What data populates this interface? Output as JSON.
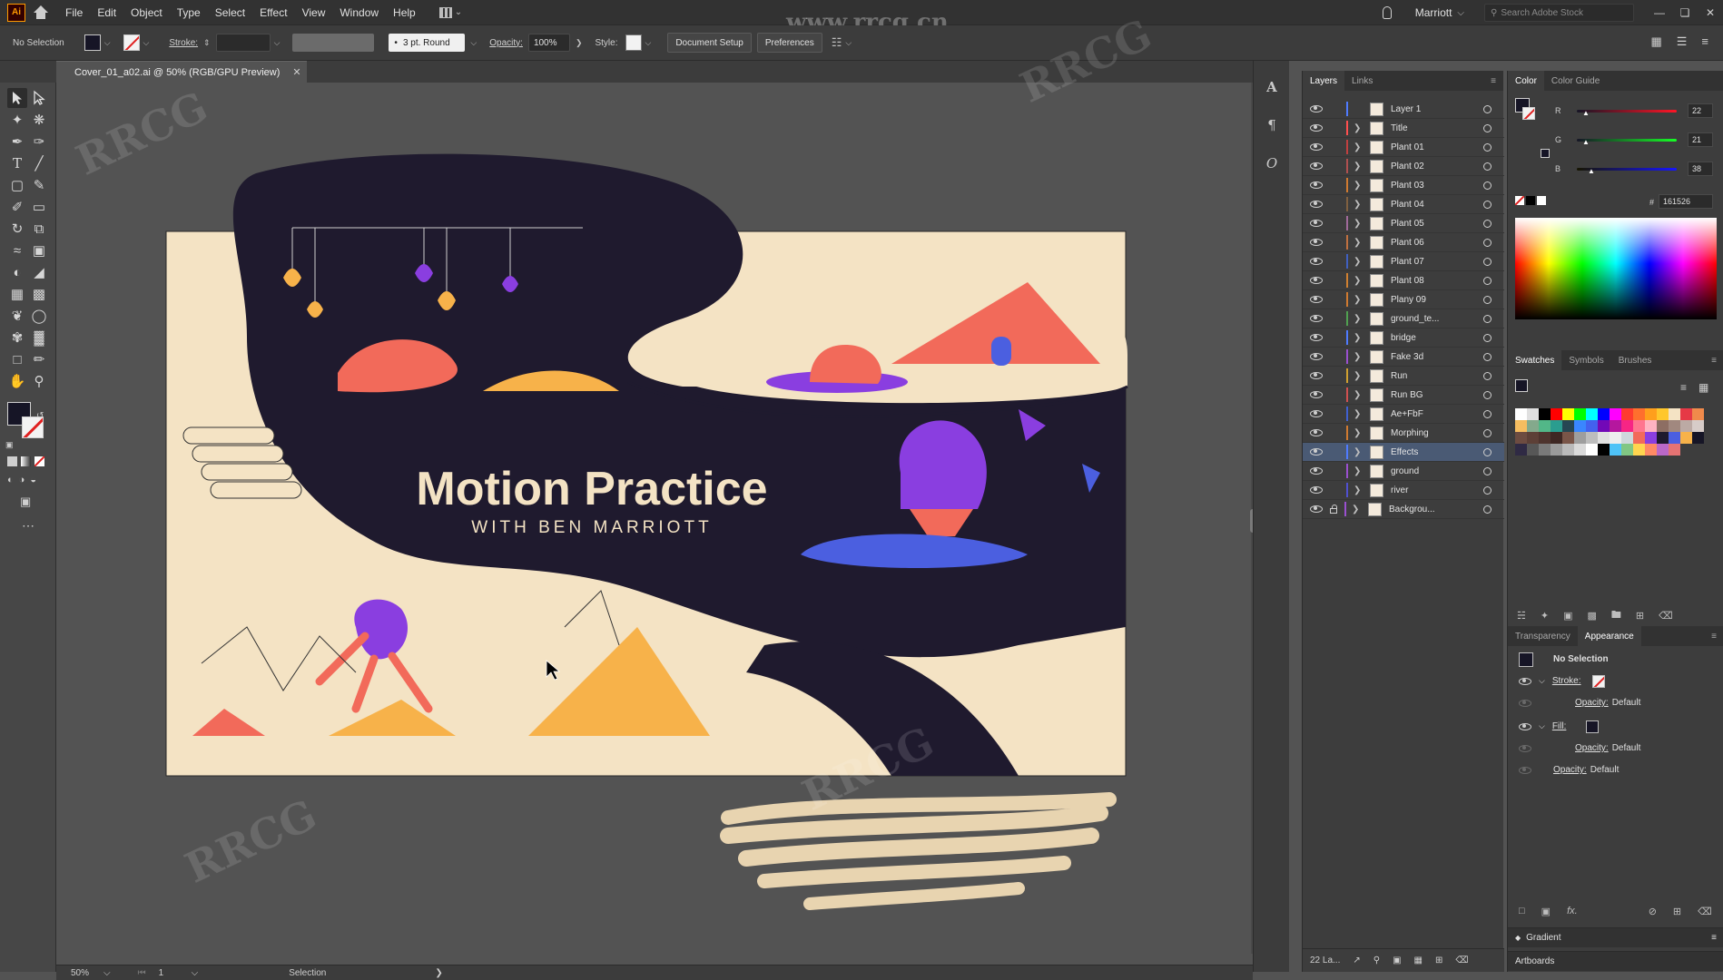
{
  "app": {
    "logo": "Ai"
  },
  "menu": [
    "File",
    "Edit",
    "Object",
    "Type",
    "Select",
    "Effect",
    "View",
    "Window",
    "Help"
  ],
  "header": {
    "user": "Marriott",
    "search_placeholder": "Search Adobe Stock",
    "watermark_top": "www.rrcg.cn"
  },
  "control": {
    "selection_status": "No Selection",
    "stroke_label": "Stroke:",
    "brush": "3 pt. Round",
    "opacity_label": "Opacity:",
    "opacity_value": "100%",
    "style_label": "Style:",
    "doc_setup_label": "Document Setup",
    "preferences_label": "Preferences"
  },
  "document": {
    "tab_title": "Cover_01_a02.ai @ 50% (RGB/GPU Preview)",
    "artwork_title": "Motion Practice",
    "artwork_subtitle": "WITH BEN MARRIOTT"
  },
  "status": {
    "zoom": "50%",
    "artboard_number": "1",
    "tool": "Selection",
    "layer_count": "22 La..."
  },
  "layers_panel": {
    "tabs": [
      "Layers",
      "Links"
    ],
    "layers": [
      {
        "name": "Layer 1",
        "color": "#4f7bff",
        "has_children": false,
        "locked": false,
        "selected": false
      },
      {
        "name": "Title",
        "color": "#ff4f4f",
        "has_children": true,
        "locked": false,
        "selected": false
      },
      {
        "name": "Plant 01",
        "color": "#c04040",
        "has_children": true,
        "locked": false,
        "selected": false
      },
      {
        "name": "Plant 02",
        "color": "#b05050",
        "has_children": true,
        "locked": false,
        "selected": false
      },
      {
        "name": "Plant 03",
        "color": "#d07a30",
        "has_children": true,
        "locked": false,
        "selected": false
      },
      {
        "name": "Plant 04",
        "color": "#806040",
        "has_children": true,
        "locked": false,
        "selected": false
      },
      {
        "name": "Plant 05",
        "color": "#a06a9a",
        "has_children": true,
        "locked": false,
        "selected": false
      },
      {
        "name": "Plant 06",
        "color": "#c07040",
        "has_children": true,
        "locked": false,
        "selected": false
      },
      {
        "name": "Plant 07",
        "color": "#4060c0",
        "has_children": true,
        "locked": false,
        "selected": false
      },
      {
        "name": "Plant 08",
        "color": "#d08030",
        "has_children": true,
        "locked": false,
        "selected": false
      },
      {
        "name": "Plany 09",
        "color": "#d07a30",
        "has_children": true,
        "locked": false,
        "selected": false
      },
      {
        "name": "ground_te...",
        "color": "#50a050",
        "has_children": true,
        "locked": false,
        "selected": false
      },
      {
        "name": "bridge",
        "color": "#4f7bff",
        "has_children": true,
        "locked": false,
        "selected": false
      },
      {
        "name": "Fake 3d",
        "color": "#9a50d0",
        "has_children": true,
        "locked": false,
        "selected": false
      },
      {
        "name": "Run",
        "color": "#d0a030",
        "has_children": true,
        "locked": false,
        "selected": false
      },
      {
        "name": "Run BG",
        "color": "#d05050",
        "has_children": true,
        "locked": false,
        "selected": false
      },
      {
        "name": "Ae+FbF",
        "color": "#4060d0",
        "has_children": true,
        "locked": false,
        "selected": false
      },
      {
        "name": "Morphing",
        "color": "#d07a30",
        "has_children": true,
        "locked": false,
        "selected": false
      },
      {
        "name": "Effects",
        "color": "#4f7bff",
        "has_children": true,
        "locked": false,
        "selected": true
      },
      {
        "name": "ground",
        "color": "#9a50d0",
        "has_children": true,
        "locked": false,
        "selected": false
      },
      {
        "name": "river",
        "color": "#5050d0",
        "has_children": true,
        "locked": false,
        "selected": false
      },
      {
        "name": "Backgrou...",
        "color": "#9a50d0",
        "has_children": true,
        "locked": true,
        "selected": false
      }
    ]
  },
  "color_panel": {
    "tabs": [
      "Color",
      "Color Guide"
    ],
    "r_label": "R",
    "g_label": "G",
    "b_label": "B",
    "r": "22",
    "g": "21",
    "b": "38",
    "hex_label": "#",
    "hex": "161526"
  },
  "swatches_panel": {
    "tabs": [
      "Swatches",
      "Symbols",
      "Brushes"
    ]
  },
  "appearance_panel": {
    "tabs": [
      "Transparency",
      "Appearance"
    ],
    "title": "No Selection",
    "stroke_label": "Stroke:",
    "fill_label": "Fill:",
    "opacity_label": "Opacity:",
    "opacity_value": "Default"
  },
  "collapsed_panels": [
    "Gradient",
    "Artboards"
  ],
  "colors": {
    "accent_selected": "#4a5a74",
    "artwork_dark": "#1f1a2e",
    "artwork_cream": "#f4e3c4",
    "artwork_purple": "#8a3ee0",
    "artwork_coral": "#f26a5a",
    "artwork_orange": "#f7b24a",
    "artwork_blue": "#4b5fe0"
  }
}
